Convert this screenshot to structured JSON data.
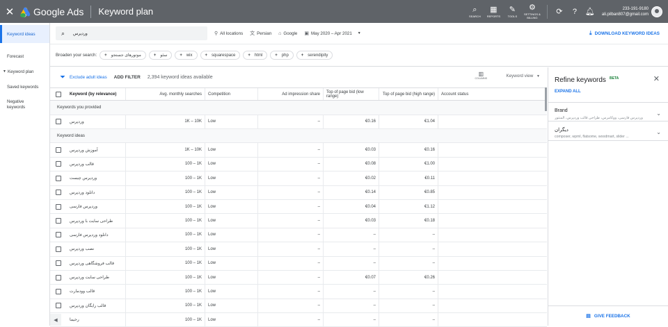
{
  "topbar": {
    "brand": "Google Ads",
    "page_title": "Keyword plan",
    "tools": [
      {
        "icon": "search-icon",
        "glyph": "⌕",
        "label": "SEARCH"
      },
      {
        "icon": "reports-icon",
        "glyph": "▦",
        "label": "REPORTS"
      },
      {
        "icon": "tools-icon",
        "glyph": "✎",
        "label": "TOOLS"
      },
      {
        "icon": "settings-icon",
        "glyph": "⚙",
        "label": "SETTINGS & BILLING"
      }
    ],
    "account_id": "233-191-9180",
    "account_email": "ali.pilban807@gmail.com"
  },
  "sidenav": {
    "items": [
      "Keyword ideas",
      "Forecast",
      "Keyword plan",
      "Saved keywords",
      "Negative keywords"
    ]
  },
  "search": {
    "value": "وردپرس",
    "location": "All locations",
    "language": "Persian",
    "network": "Google",
    "date_range": "May 2020 – Apr 2021",
    "download_label": "DOWNLOAD KEYWORD IDEAS"
  },
  "broaden": {
    "label": "Broaden your search:",
    "chips": [
      "موتورهای جستجو",
      "سئو",
      "wix",
      "squarespace",
      "html",
      "php",
      "serendipity"
    ]
  },
  "toolbar": {
    "exclude_label": "Exclude adult ideas",
    "add_filter": "ADD FILTER",
    "count": "2,394 keyword ideas available",
    "columns_label": "COLUMNS",
    "view_label": "Keyword view"
  },
  "table": {
    "headers": [
      "Keyword (by relevance)",
      "Avg. monthly searches",
      "Competition",
      "Ad impression share",
      "Top of page bid (low range)",
      "Top of page bid (high range)",
      "Account status"
    ],
    "group_provided": "Keywords you provided",
    "provided_rows": [
      {
        "keyword": "وردپرس",
        "searches": "1K – 10K",
        "competition": "Low",
        "share": "–",
        "low": "€0.16",
        "high": "€1.04"
      }
    ],
    "group_ideas": "Keyword ideas",
    "idea_rows": [
      {
        "keyword": "آموزش وردپرس",
        "searches": "1K – 10K",
        "competition": "Low",
        "share": "–",
        "low": "€0.03",
        "high": "€0.16"
      },
      {
        "keyword": "قالب وردپرس",
        "searches": "100 – 1K",
        "competition": "Low",
        "share": "–",
        "low": "€0.08",
        "high": "€1.00"
      },
      {
        "keyword": "وردپرس چیست",
        "searches": "100 – 1K",
        "competition": "Low",
        "share": "–",
        "low": "€0.02",
        "high": "€0.11"
      },
      {
        "keyword": "دانلود وردپرس",
        "searches": "100 – 1K",
        "competition": "Low",
        "share": "–",
        "low": "€0.14",
        "high": "€0.85"
      },
      {
        "keyword": "وردپرس فارسی",
        "searches": "100 – 1K",
        "competition": "Low",
        "share": "–",
        "low": "€0.04",
        "high": "€1.12"
      },
      {
        "keyword": "طراحی سایت با وردپرس",
        "searches": "100 – 1K",
        "competition": "Low",
        "share": "–",
        "low": "€0.03",
        "high": "€0.18"
      },
      {
        "keyword": "دانلود وردپرس فارسی",
        "searches": "100 – 1K",
        "competition": "Low",
        "share": "–",
        "low": "–",
        "high": "–"
      },
      {
        "keyword": "نصب وردپرس",
        "searches": "100 – 1K",
        "competition": "Low",
        "share": "–",
        "low": "–",
        "high": "–"
      },
      {
        "keyword": "قالب فروشگاهی وردپرس",
        "searches": "100 – 1K",
        "competition": "Low",
        "share": "–",
        "low": "–",
        "high": "–"
      },
      {
        "keyword": "طراحی سایت وردپرس",
        "searches": "100 – 1K",
        "competition": "Low",
        "share": "–",
        "low": "€0.07",
        "high": "€0.26"
      },
      {
        "keyword": "قالب وودمارت",
        "searches": "100 – 1K",
        "competition": "Low",
        "share": "–",
        "low": "–",
        "high": "–"
      },
      {
        "keyword": "قالب رایگان وردپرس",
        "searches": "100 – 1K",
        "competition": "Low",
        "share": "–",
        "low": "–",
        "high": "–"
      },
      {
        "keyword": "رخیما",
        "searches": "100 – 1K",
        "competition": "Low",
        "share": "–",
        "low": "–",
        "high": "–"
      }
    ]
  },
  "refine": {
    "title": "Refine keywords",
    "beta": "BETA",
    "expand_all": "EXPAND ALL",
    "sections": [
      {
        "heading": "Brand",
        "sub": "وردپرس فارسی، ووکامرس، طراحی قالب وردپرس، المنتور"
      },
      {
        "heading": "دیگران",
        "sub": "composer, wpml, flatsome, woodmart, slider ..."
      }
    ],
    "feedback": "GIVE FEEDBACK"
  },
  "colors": {
    "accent": "#1a73e8",
    "topbar": "#5f6368",
    "beta": "#188038"
  }
}
